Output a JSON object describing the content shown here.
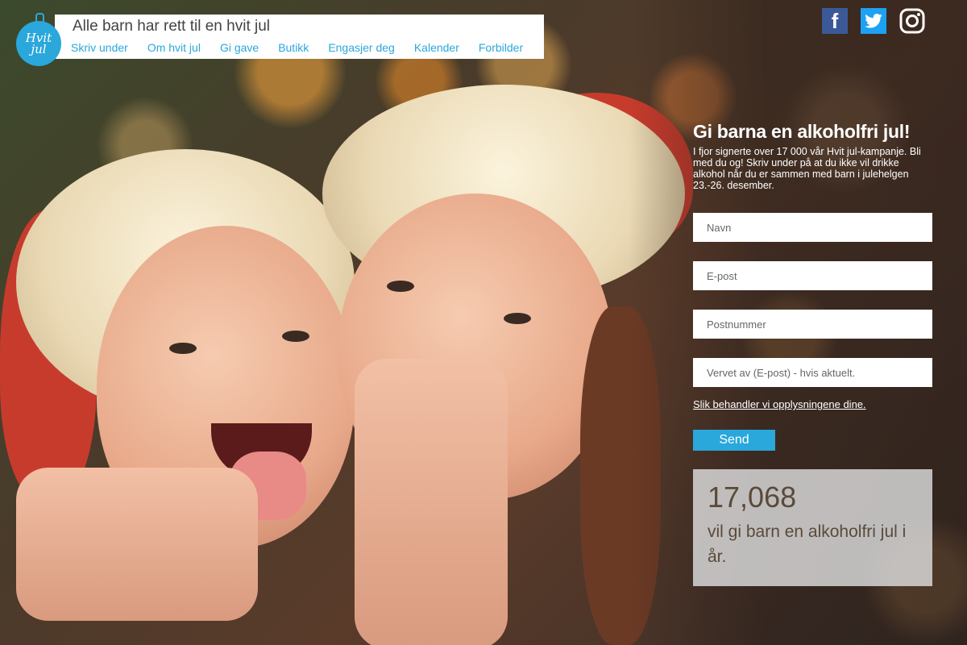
{
  "header": {
    "logo_text": "Hvit jul",
    "site_title": "Alle barn har rett til en hvit jul",
    "nav": [
      "Skriv under",
      "Om hvit jul",
      "Gi gave",
      "Butikk",
      "Engasjer deg",
      "Kalender",
      "Forbilder"
    ]
  },
  "social": {
    "facebook_icon": "f",
    "twitter_icon": "twitter-bird"
  },
  "form": {
    "heading": "Gi barna en alkoholfri jul!",
    "intro": "I fjor signerte over 17 000 vår Hvit jul-kampanje. Bli med du og! Skriv under på at du ikke vil drikke alkohol når du er sammen med barn i julehelgen 23.-26. desember.",
    "name_placeholder": "Navn",
    "email_placeholder": "E-post",
    "postal_placeholder": "Postnummer",
    "referrer_placeholder": "Vervet av (E-post) - hvis aktuelt.",
    "privacy_link": "Slik behandler vi opplysningene dine.",
    "send_label": "Send"
  },
  "counter": {
    "count": "17,068",
    "text": "vil gi barn en alkoholfri jul i år."
  },
  "colors": {
    "accent": "#2aa7db"
  }
}
